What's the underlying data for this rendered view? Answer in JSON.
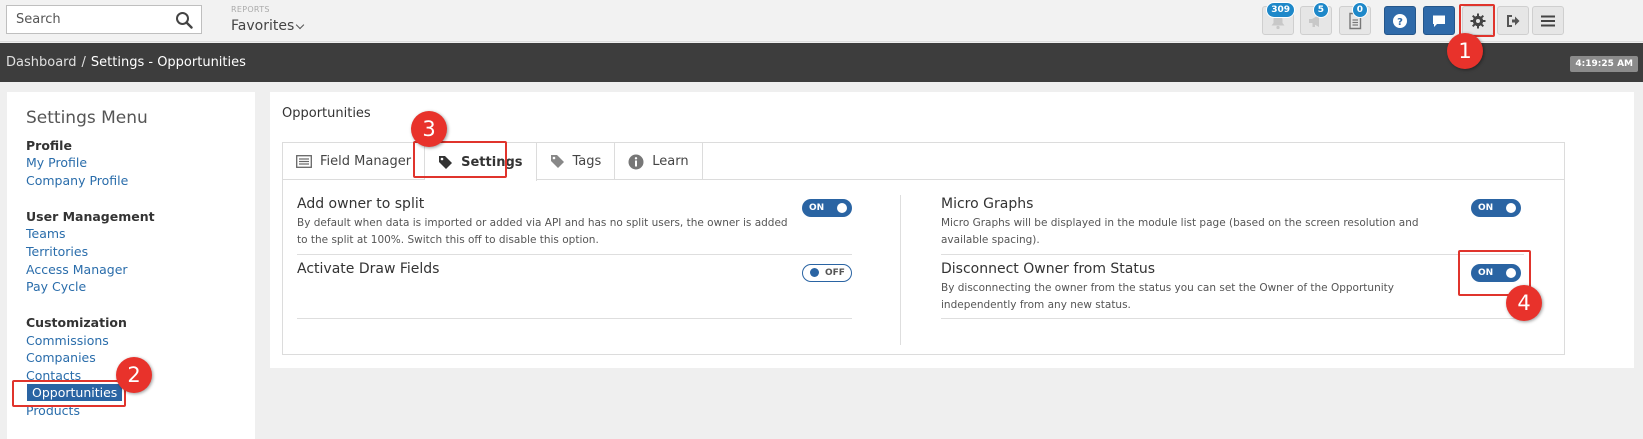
{
  "topbar": {
    "search_placeholder": "Search",
    "reports_label": "REPORTS",
    "favorites_label": "Favorites",
    "notifications_count": "309",
    "announcements_count": "5",
    "documents_count": "0"
  },
  "breadcrumb": {
    "items": [
      "Dashboard",
      "Settings - Opportunities"
    ],
    "separator": "/",
    "clock": "4:19:25 AM"
  },
  "sidebar": {
    "title": "Settings Menu",
    "sections": [
      {
        "title": "Profile",
        "items": [
          "My Profile",
          "Company Profile"
        ]
      },
      {
        "title": "User Management",
        "items": [
          "Teams",
          "Territories",
          "Access Manager",
          "Pay Cycle"
        ]
      },
      {
        "title": "Customization",
        "items": [
          "Commissions",
          "Companies",
          "Contacts",
          "Opportunities",
          "Products"
        ]
      }
    ],
    "active_item": "Opportunities"
  },
  "content": {
    "title": "Opportunities",
    "tabs": [
      "Field Manager",
      "Settings",
      "Tags",
      "Learn"
    ],
    "active_tab": "Settings",
    "left_options": [
      {
        "title": "Add owner to split",
        "desc": "By default when data is imported or added via API and has no split users, the owner is added to the split at 100%. Switch this off to disable this option.",
        "state": "ON"
      },
      {
        "title": "Activate Draw Fields",
        "desc": "",
        "state": "OFF"
      }
    ],
    "right_options": [
      {
        "title": "Micro Graphs",
        "desc": "Micro Graphs will be displayed in the module list page (based on the screen resolution and available spacing).",
        "state": "ON"
      },
      {
        "title": "Disconnect Owner from Status",
        "desc": "By disconnecting the owner from the status you can set the Owner of the Opportunity independently from any new status.",
        "state": "ON"
      }
    ]
  },
  "annotations": {
    "markers": [
      "1",
      "2",
      "3",
      "4"
    ],
    "color": "#e8322b"
  },
  "colors": {
    "accent": "#2a64a3",
    "header_dark": "#3d3d3d"
  }
}
